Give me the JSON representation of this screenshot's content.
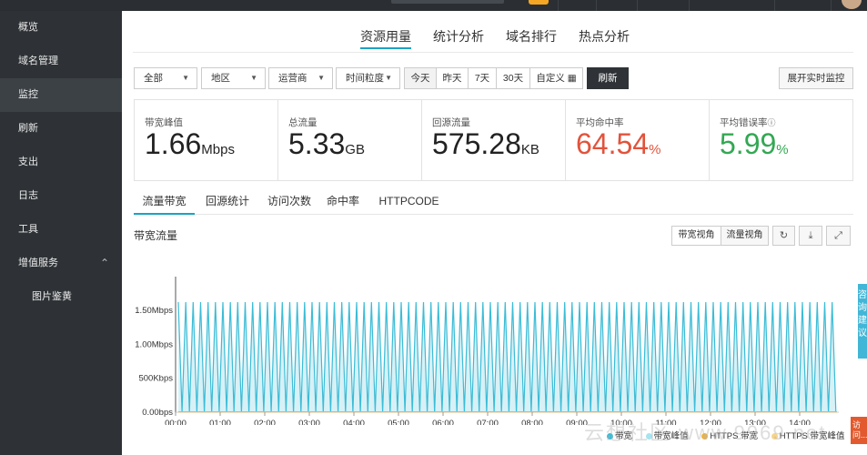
{
  "sidebar": {
    "items": [
      {
        "label": "概览"
      },
      {
        "label": "域名管理"
      },
      {
        "label": "监控",
        "active": true
      },
      {
        "label": "刷新"
      },
      {
        "label": "支出"
      },
      {
        "label": "日志"
      },
      {
        "label": "工具"
      },
      {
        "label": "增值服务",
        "expanded": true
      },
      {
        "label": "图片鉴黄",
        "sub": true
      }
    ]
  },
  "main": {
    "tabs": [
      {
        "label": "资源用量",
        "active": true
      },
      {
        "label": "统计分析"
      },
      {
        "label": "域名排行"
      },
      {
        "label": "热点分析"
      }
    ]
  },
  "filters": {
    "all": "全部",
    "region": "地区",
    "isp": "运营商",
    "granularity": "时间粒度",
    "ranges": [
      "今天",
      "昨天",
      "7天",
      "30天"
    ],
    "custom": "自定义",
    "refresh": "刷新",
    "realtime": "展开实时监控"
  },
  "stats": [
    {
      "label": "带宽峰值",
      "value": "1.66",
      "unit": "Mbps"
    },
    {
      "label": "总流量",
      "value": "5.33",
      "unit": "GB"
    },
    {
      "label": "回源流量",
      "value": "575.28",
      "unit": "KB"
    },
    {
      "label": "平均命中率",
      "value": "64.54",
      "unit": "%",
      "color": "#e2533c"
    },
    {
      "label": "平均错误率",
      "value": "5.99",
      "unit": "%",
      "color": "#33a853"
    }
  ],
  "subtabs": [
    {
      "label": "流量带宽",
      "active": true
    },
    {
      "label": "回源统计"
    },
    {
      "label": "访问次数"
    },
    {
      "label": "命中率"
    },
    {
      "label": "HTTPCODE"
    }
  ],
  "chart_section": {
    "title": "带宽流量",
    "view_bandwidth": "带宽视角",
    "view_traffic": "流量视角"
  },
  "chart_data": {
    "type": "area",
    "y_ticks": [
      "0.00bps",
      "500Kbps",
      "1.00Mbps",
      "1.50Mbps"
    ],
    "ylim_mbps": [
      0,
      1.5
    ],
    "x_ticks": [
      "00:00",
      "01:00",
      "02:00",
      "03:00",
      "04:00",
      "05:00",
      "06:00",
      "07:00",
      "08:00",
      "09:00",
      "10:00",
      "11:00",
      "12:00",
      "13:00",
      "14:00"
    ],
    "pattern": "alternating 0 / ~1.62 Mbps at 5-minute intervals, 00:00 to ~14:40",
    "peak_mbps": 1.62,
    "series": [
      {
        "name": "带宽",
        "color": "#3cbcd6"
      },
      {
        "name": "带宽峰值",
        "color": "#a6e4ef"
      },
      {
        "name": "HTTPS 带宽",
        "color": "#f0b23c"
      },
      {
        "name": "HTTPS 带宽峰值",
        "color": "#f6d48a"
      }
    ]
  },
  "side_float": {
    "text": "咨询建议"
  },
  "side_float2": {
    "text": "访问..."
  },
  "watermark": "云想社区 www.9969.net"
}
